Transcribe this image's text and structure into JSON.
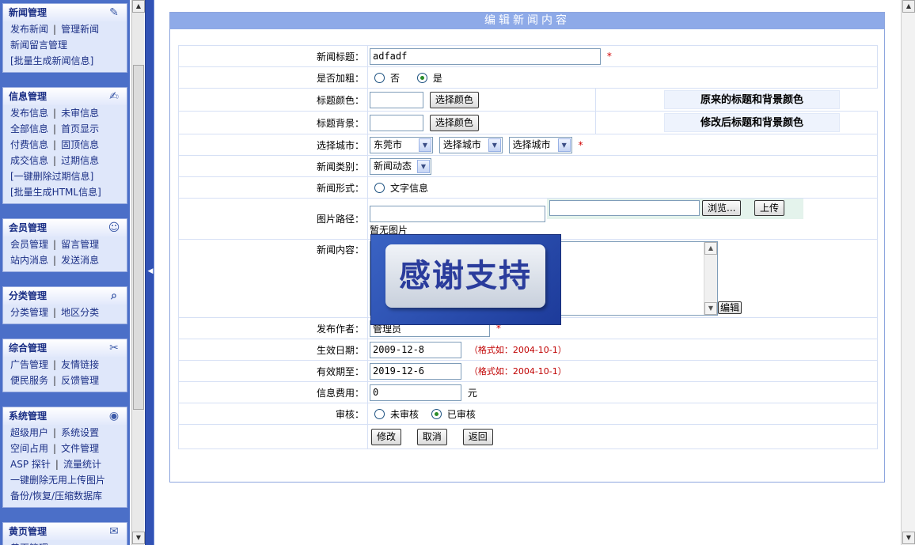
{
  "sidebar": {
    "sections": [
      {
        "title": "新闻管理",
        "icon": "news-icon",
        "rows": [
          [
            "发布新闻",
            "管理新闻"
          ],
          [
            "新闻留言管理"
          ],
          [
            "[批量生成新闻信息]"
          ]
        ]
      },
      {
        "title": "信息管理",
        "icon": "edit-icon",
        "rows": [
          [
            "发布信息",
            "未审信息"
          ],
          [
            "全部信息",
            "首页显示"
          ],
          [
            "付费信息",
            "固顶信息"
          ],
          [
            "成交信息",
            "过期信息"
          ],
          [
            "[一键删除过期信息]"
          ],
          [
            "[批量生成HTML信息]"
          ]
        ]
      },
      {
        "title": "会员管理",
        "icon": "users-icon",
        "rows": [
          [
            "会员管理",
            "留言管理"
          ],
          [
            "站内消息",
            "发送消息"
          ]
        ]
      },
      {
        "title": "分类管理",
        "icon": "search-icon",
        "rows": [
          [
            "分类管理",
            "地区分类"
          ]
        ]
      },
      {
        "title": "综合管理",
        "icon": "tools-icon",
        "rows": [
          [
            "广告管理",
            "友情链接"
          ],
          [
            "便民服务",
            "反馈管理"
          ]
        ]
      },
      {
        "title": "系统管理",
        "icon": "globe-icon",
        "rows": [
          [
            "超级用户",
            "系统设置"
          ],
          [
            "空间占用",
            "文件管理"
          ],
          [
            "ASP 探针",
            "流量统计"
          ],
          [
            "一键删除无用上传图片"
          ],
          [
            "备份/恢复/压缩数据库"
          ]
        ]
      },
      {
        "title": "黄页管理",
        "icon": "book-icon",
        "rows": [
          [
            "黄页管理"
          ]
        ]
      }
    ]
  },
  "form": {
    "title": "编辑新闻内容",
    "news_title_label": "新闻标题：",
    "news_title_value": "adfadf",
    "bold_label": "是否加粗：",
    "bold_options": [
      "否",
      "是"
    ],
    "bold_selected": "是",
    "title_color_label": "标题颜色：",
    "title_bg_label": "标题背景：",
    "choose_color_button": "选择颜色",
    "original_color_text": "原来的标题和背景颜色",
    "modified_color_text": "修改后标题和背景颜色",
    "city_label": "选择城市：",
    "city_selects": [
      "东莞市",
      "选择城市",
      "选择城市"
    ],
    "category_label": "新闻类别：",
    "category_value": "新闻动态",
    "format_label": "新闻形式：",
    "format_option": "文字信息",
    "image_path_label": "图片路径：",
    "browse_button": "浏览...",
    "upload_button": "上传",
    "no_image_text": "暂无图片",
    "content_label": "新闻内容：",
    "edit_button": "编辑",
    "author_label": "发布作者：",
    "author_value": "管理员",
    "start_date_label": "生效日期：",
    "start_date_value": "2009-12-8",
    "end_date_label": "有效期至：",
    "end_date_value": "2019-12-6",
    "date_hint": "（格式如：2004-10-1）",
    "fee_label": "信息费用：",
    "fee_value": "0",
    "fee_unit": "元",
    "review_label": "审核：",
    "review_options": [
      "未审核",
      "已审核"
    ],
    "review_selected": "已审核",
    "modify_button": "修改",
    "cancel_button": "取消",
    "back_button": "返回",
    "required_mark": "*"
  },
  "stamp": {
    "text": "感谢支持"
  },
  "colors": {
    "sidebar_bg": "#4b6fc8",
    "panel_header": "#8eaae8",
    "menu_text": "#1b2f85",
    "required": "#d00000"
  }
}
